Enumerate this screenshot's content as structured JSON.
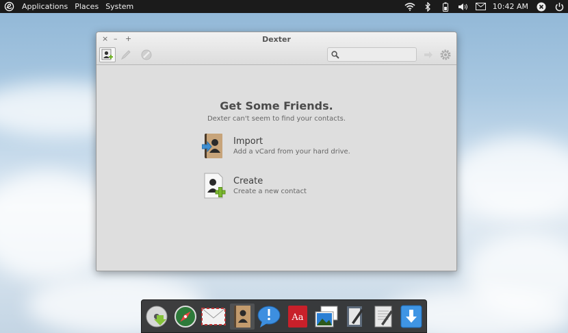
{
  "panel": {
    "menus": [
      "Applications",
      "Places",
      "System"
    ],
    "clock": "10:42 AM",
    "indicators": [
      "wifi-icon",
      "bluetooth-icon",
      "battery-icon",
      "volume-icon",
      "mail-icon",
      "status-close-icon",
      "power-icon"
    ]
  },
  "window": {
    "title": "Dexter",
    "controls": {
      "close": "×",
      "minimize": "–",
      "maximize": "+"
    },
    "toolbar": [
      "new-contact-icon",
      "edit-icon",
      "delete-icon",
      "search-icon",
      "export-icon",
      "settings-icon"
    ],
    "search": {
      "value": "",
      "placeholder": ""
    }
  },
  "empty_state": {
    "title": "Get Some Friends.",
    "subtitle": "Dexter can't seem to find your contacts.",
    "actions": [
      {
        "title": "Import",
        "description": "Add a vCard from your hard drive.",
        "icon": "import-contacts-icon"
      },
      {
        "title": "Create",
        "description": "Create a new contact",
        "icon": "create-contact-icon"
      }
    ]
  },
  "dock": {
    "items": [
      "disc-install-icon",
      "browser-compass-icon",
      "mail-envelope-icon",
      "contacts-book-icon",
      "chat-bubble-icon",
      "dictionary-icon",
      "photos-icon",
      "text-editor-icon",
      "notes-icon",
      "downloads-icon"
    ],
    "running": "contacts-book-icon"
  },
  "colors": {
    "panel": "#1b1b1b",
    "window": "#dedede",
    "accent_green": "#7cb82f",
    "dock": "#232323"
  }
}
